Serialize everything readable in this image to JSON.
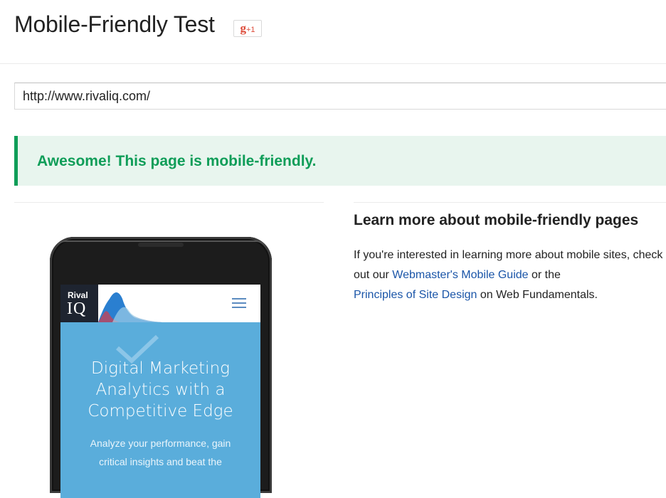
{
  "header": {
    "title": "Mobile-Friendly Test",
    "gplus_g": "g",
    "gplus_plus": "+1"
  },
  "url_input": {
    "value": "http://www.rivaliq.com/"
  },
  "result": {
    "message": "Awesome! This page is mobile-friendly.",
    "status_color": "#0f9d58"
  },
  "learn_more": {
    "heading": "Learn more about mobile-friendly pages",
    "text_1": "If you're interested in learning more about mobile sites, check out our ",
    "link_1": "Webmaster's Mobile Guide",
    "text_2": " or the ",
    "link_2": "Principles of Site Design",
    "text_3": " on Web Fundamentals."
  },
  "preview": {
    "logo_line1": "Rival",
    "logo_line2": "IQ",
    "hero_title_1": "Digital Marketing",
    "hero_title_2": "Analytics with a",
    "hero_title_3": "Competitive Edge",
    "hero_sub_1": "Analyze your performance, gain",
    "hero_sub_2": "critical insights and beat the",
    "icons": [
      "menu-icon",
      "checkmark-icon"
    ]
  }
}
